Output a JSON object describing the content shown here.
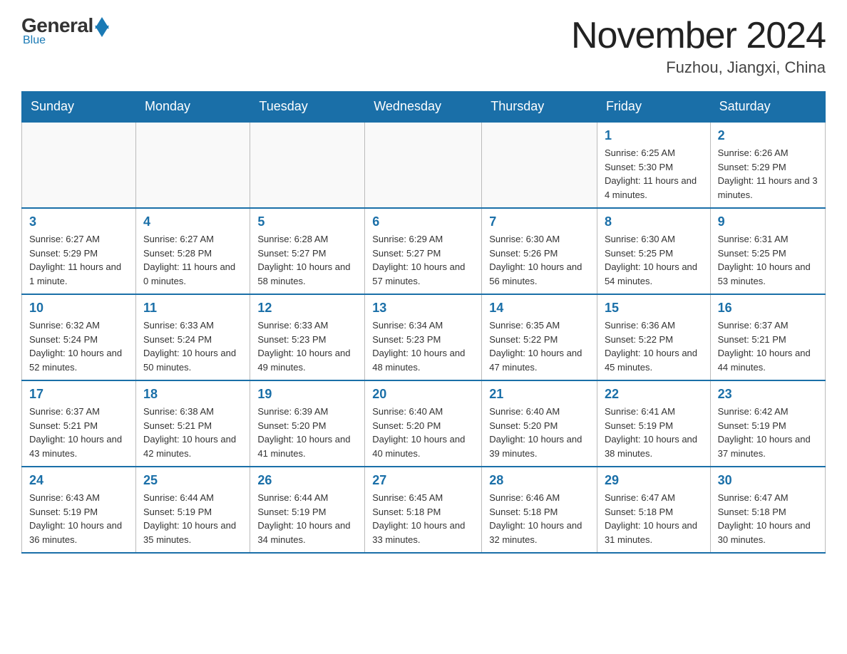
{
  "logo": {
    "general": "General",
    "blue": "Blue",
    "arrow": "▲"
  },
  "title": "November 2024",
  "location": "Fuzhou, Jiangxi, China",
  "weekdays": [
    "Sunday",
    "Monday",
    "Tuesday",
    "Wednesday",
    "Thursday",
    "Friday",
    "Saturday"
  ],
  "weeks": [
    [
      {
        "day": "",
        "info": ""
      },
      {
        "day": "",
        "info": ""
      },
      {
        "day": "",
        "info": ""
      },
      {
        "day": "",
        "info": ""
      },
      {
        "day": "",
        "info": ""
      },
      {
        "day": "1",
        "info": "Sunrise: 6:25 AM\nSunset: 5:30 PM\nDaylight: 11 hours and 4 minutes."
      },
      {
        "day": "2",
        "info": "Sunrise: 6:26 AM\nSunset: 5:29 PM\nDaylight: 11 hours and 3 minutes."
      }
    ],
    [
      {
        "day": "3",
        "info": "Sunrise: 6:27 AM\nSunset: 5:29 PM\nDaylight: 11 hours and 1 minute."
      },
      {
        "day": "4",
        "info": "Sunrise: 6:27 AM\nSunset: 5:28 PM\nDaylight: 11 hours and 0 minutes."
      },
      {
        "day": "5",
        "info": "Sunrise: 6:28 AM\nSunset: 5:27 PM\nDaylight: 10 hours and 58 minutes."
      },
      {
        "day": "6",
        "info": "Sunrise: 6:29 AM\nSunset: 5:27 PM\nDaylight: 10 hours and 57 minutes."
      },
      {
        "day": "7",
        "info": "Sunrise: 6:30 AM\nSunset: 5:26 PM\nDaylight: 10 hours and 56 minutes."
      },
      {
        "day": "8",
        "info": "Sunrise: 6:30 AM\nSunset: 5:25 PM\nDaylight: 10 hours and 54 minutes."
      },
      {
        "day": "9",
        "info": "Sunrise: 6:31 AM\nSunset: 5:25 PM\nDaylight: 10 hours and 53 minutes."
      }
    ],
    [
      {
        "day": "10",
        "info": "Sunrise: 6:32 AM\nSunset: 5:24 PM\nDaylight: 10 hours and 52 minutes."
      },
      {
        "day": "11",
        "info": "Sunrise: 6:33 AM\nSunset: 5:24 PM\nDaylight: 10 hours and 50 minutes."
      },
      {
        "day": "12",
        "info": "Sunrise: 6:33 AM\nSunset: 5:23 PM\nDaylight: 10 hours and 49 minutes."
      },
      {
        "day": "13",
        "info": "Sunrise: 6:34 AM\nSunset: 5:23 PM\nDaylight: 10 hours and 48 minutes."
      },
      {
        "day": "14",
        "info": "Sunrise: 6:35 AM\nSunset: 5:22 PM\nDaylight: 10 hours and 47 minutes."
      },
      {
        "day": "15",
        "info": "Sunrise: 6:36 AM\nSunset: 5:22 PM\nDaylight: 10 hours and 45 minutes."
      },
      {
        "day": "16",
        "info": "Sunrise: 6:37 AM\nSunset: 5:21 PM\nDaylight: 10 hours and 44 minutes."
      }
    ],
    [
      {
        "day": "17",
        "info": "Sunrise: 6:37 AM\nSunset: 5:21 PM\nDaylight: 10 hours and 43 minutes."
      },
      {
        "day": "18",
        "info": "Sunrise: 6:38 AM\nSunset: 5:21 PM\nDaylight: 10 hours and 42 minutes."
      },
      {
        "day": "19",
        "info": "Sunrise: 6:39 AM\nSunset: 5:20 PM\nDaylight: 10 hours and 41 minutes."
      },
      {
        "day": "20",
        "info": "Sunrise: 6:40 AM\nSunset: 5:20 PM\nDaylight: 10 hours and 40 minutes."
      },
      {
        "day": "21",
        "info": "Sunrise: 6:40 AM\nSunset: 5:20 PM\nDaylight: 10 hours and 39 minutes."
      },
      {
        "day": "22",
        "info": "Sunrise: 6:41 AM\nSunset: 5:19 PM\nDaylight: 10 hours and 38 minutes."
      },
      {
        "day": "23",
        "info": "Sunrise: 6:42 AM\nSunset: 5:19 PM\nDaylight: 10 hours and 37 minutes."
      }
    ],
    [
      {
        "day": "24",
        "info": "Sunrise: 6:43 AM\nSunset: 5:19 PM\nDaylight: 10 hours and 36 minutes."
      },
      {
        "day": "25",
        "info": "Sunrise: 6:44 AM\nSunset: 5:19 PM\nDaylight: 10 hours and 35 minutes."
      },
      {
        "day": "26",
        "info": "Sunrise: 6:44 AM\nSunset: 5:19 PM\nDaylight: 10 hours and 34 minutes."
      },
      {
        "day": "27",
        "info": "Sunrise: 6:45 AM\nSunset: 5:18 PM\nDaylight: 10 hours and 33 minutes."
      },
      {
        "day": "28",
        "info": "Sunrise: 6:46 AM\nSunset: 5:18 PM\nDaylight: 10 hours and 32 minutes."
      },
      {
        "day": "29",
        "info": "Sunrise: 6:47 AM\nSunset: 5:18 PM\nDaylight: 10 hours and 31 minutes."
      },
      {
        "day": "30",
        "info": "Sunrise: 6:47 AM\nSunset: 5:18 PM\nDaylight: 10 hours and 30 minutes."
      }
    ]
  ]
}
